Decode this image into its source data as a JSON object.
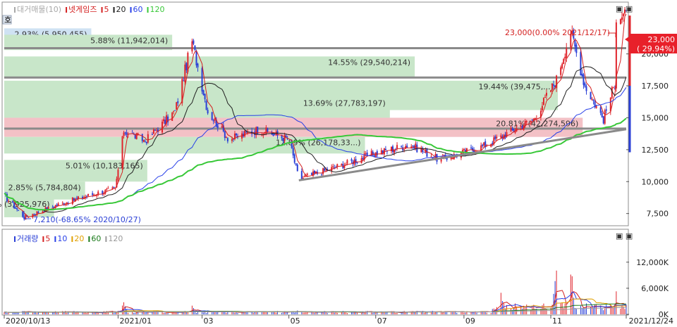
{
  "colors": {
    "up": "#e0242c",
    "down": "#2a3fd6",
    "ma5": "#d42020",
    "ma20": "#202020",
    "ma60": "#2840e8",
    "ma120": "#38c838",
    "band_green": "#c8e6c9",
    "band_red": "#f3c1c6",
    "band_blue": "#cfe2f3",
    "vol_ma5": "#d42020",
    "vol_ma10": "#2840e8",
    "vol_ma20": "#e0a000",
    "vol_ma60": "#1a7a1a",
    "vol_ma120": "#999999",
    "trend_gray": "#8a8a8a"
  },
  "price_legend": {
    "badge": "호",
    "items": [
      {
        "text": "대거매물(10)",
        "color": "#a8a8a8"
      },
      {
        "text": "넷게임즈",
        "color": "#d42020"
      },
      {
        "text": "5",
        "color": "#d42020"
      },
      {
        "text": "20",
        "color": "#202020"
      },
      {
        "text": "60",
        "color": "#2840e8"
      },
      {
        "text": "120",
        "color": "#38c838"
      }
    ]
  },
  "volume_legend": {
    "items": [
      {
        "text": "거래량",
        "color": "#2a3fd6"
      },
      {
        "text": "5",
        "color": "#d42020"
      },
      {
        "text": "10",
        "color": "#2840e8"
      },
      {
        "text": "20",
        "color": "#e0a000"
      },
      {
        "text": "60",
        "color": "#1a7a1a"
      },
      {
        "text": "120",
        "color": "#999999"
      }
    ]
  },
  "window_buttons": {
    "top": "▣ ▣",
    "bottom": "▣ ▣"
  },
  "annotations": {
    "high": "23,000(0.00% 2021/12/17)",
    "low": "7,210(-68.65% 2020/10/27)",
    "last_price": "23,000",
    "last_change": "( 29.94%)"
  },
  "volume_profile": [
    {
      "label": "2.93% (5,950,455)",
      "low": 20700,
      "high": 22000,
      "width": 0.14,
      "color": "band_blue"
    },
    {
      "label": "5.88% (11,942,014)",
      "low": 20300,
      "high": 21500,
      "width": 0.27,
      "color": "band_green"
    },
    {
      "label": "14.55% (29,540,214)",
      "low": 18100,
      "high": 19800,
      "width": 0.66,
      "color": "band_green"
    },
    {
      "label": "19.44% (39,475,...)",
      "low": 15600,
      "high": 17900,
      "width": 0.89,
      "color": "band_green"
    },
    {
      "label": "13.69% (27,783,197)",
      "low": 15000,
      "high": 16600,
      "width": 0.62,
      "color": "band_green"
    },
    {
      "label": "20.81% (42,274,596)",
      "low": 13500,
      "high": 15000,
      "width": 0.93,
      "color": "band_red"
    },
    {
      "label": "12.89% (26,178,33...)",
      "low": 12200,
      "high": 13500,
      "width": 0.58,
      "color": "band_green"
    },
    {
      "label": "5.01% (10,183,165)",
      "low": 10000,
      "high": 11700,
      "width": 0.23,
      "color": "band_green"
    },
    {
      "label": "2.85% (5,784,804)",
      "low": 8600,
      "high": 10000,
      "width": 0.13,
      "color": "band_green"
    },
    {
      "label": "...94% (3,925,976)",
      "low": 7210,
      "high": 8700,
      "width": 0.08,
      "color": "band_green"
    }
  ],
  "support_lines": [
    20450,
    18150,
    14150
  ],
  "chart_data": [
    {
      "type": "candlestick",
      "title": "넷게임즈",
      "x_range": [
        "2020/10/13",
        "2021/12/24"
      ],
      "x_ticks": [
        "2020/10/13",
        "2021/01",
        "03",
        "05",
        "07",
        "09",
        "11",
        "2021/12/24"
      ],
      "y_ticks": [
        "7,500",
        "10,000",
        "12,500",
        "15,000",
        "17,500",
        "20,000"
      ],
      "ylim": [
        6600,
        24000
      ],
      "anchor_prices": [
        [
          "2020/10/13",
          8900
        ],
        [
          "2020/10/27",
          7210
        ],
        [
          "2020/11/20",
          8200
        ],
        [
          "2020/12/20",
          9200
        ],
        [
          "2020/12/30",
          9400
        ],
        [
          "2021/01/05",
          14000
        ],
        [
          "2021/01/20",
          13200
        ],
        [
          "2021/02/10",
          15500
        ],
        [
          "2021/02/22",
          21000
        ],
        [
          "2021/03/05",
          15500
        ],
        [
          "2021/03/20",
          13300
        ],
        [
          "2021/04/10",
          14100
        ],
        [
          "2021/05/01",
          13300
        ],
        [
          "2021/05/08",
          10200
        ],
        [
          "2021/06/10",
          11400
        ],
        [
          "2021/06/30",
          12200
        ],
        [
          "2021/07/25",
          12900
        ],
        [
          "2021/08/15",
          11700
        ],
        [
          "2021/09/15",
          12800
        ],
        [
          "2021/10/20",
          14900
        ],
        [
          "2021/11/05",
          18000
        ],
        [
          "2021/11/15",
          21800
        ],
        [
          "2021/11/25",
          17500
        ],
        [
          "2021/12/08",
          14900
        ],
        [
          "2021/12/16",
          17700
        ],
        [
          "2021/12/17",
          23000
        ],
        [
          "2021/12/22",
          23000
        ]
      ],
      "trendlines": [
        {
          "from": [
            "2021/05/08",
            10100
          ],
          "to": [
            "2021/12/24",
            14100
          ]
        }
      ]
    },
    {
      "type": "bar",
      "title": "거래량",
      "y_ticks": [
        "12,000K",
        "6,000K",
        "0K"
      ],
      "ylim": [
        0,
        16500
      ],
      "spikes": [
        [
          "2021/01/05",
          3200
        ],
        [
          "2021/02/22",
          2100
        ],
        [
          "2021/05/08",
          1400
        ],
        [
          "2021/09/27",
          5200
        ],
        [
          "2021/11/05",
          14000
        ],
        [
          "2021/11/15",
          14500
        ],
        [
          "2021/12/17",
          5500
        ]
      ]
    }
  ]
}
